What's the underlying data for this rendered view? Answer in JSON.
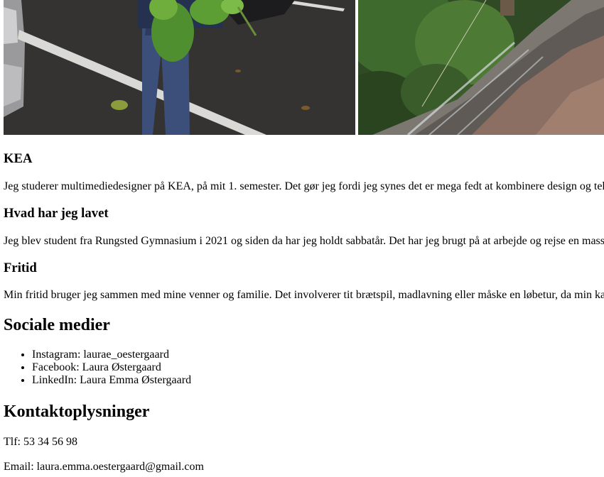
{
  "sections": {
    "kea": {
      "heading": "KEA",
      "text": "Jeg studerer multimediedesigner på KEA, på mit 1. semester. Det gør jeg fordi jeg synes det er mega fedt at kombinere design og tekn"
    },
    "lavet": {
      "heading": "Hvad har jeg lavet",
      "text": "Jeg blev student fra Rungsted Gymnasium i 2021 og siden da har jeg holdt sabbatår. Det har jeg brugt på at arbejde og rejse en masse"
    },
    "fritid": {
      "heading": "Fritid",
      "text": "Min fritid bruger jeg sammen med mine venner og familie. Det involverer tit brætspil, madlavning eller måske en løbetur, da min kær"
    }
  },
  "social": {
    "heading": "Sociale medier",
    "items": [
      "Instagram: laurae_oestergaard",
      "Facebook: Laura Østergaard",
      "LinkedIn: Laura Emma Østergaard"
    ]
  },
  "contact": {
    "heading": "Kontaktoplysninger",
    "phone": "Tlf: 53 34 56 98",
    "email": "Email: laura.emma.oestergaard@gmail.com"
  }
}
